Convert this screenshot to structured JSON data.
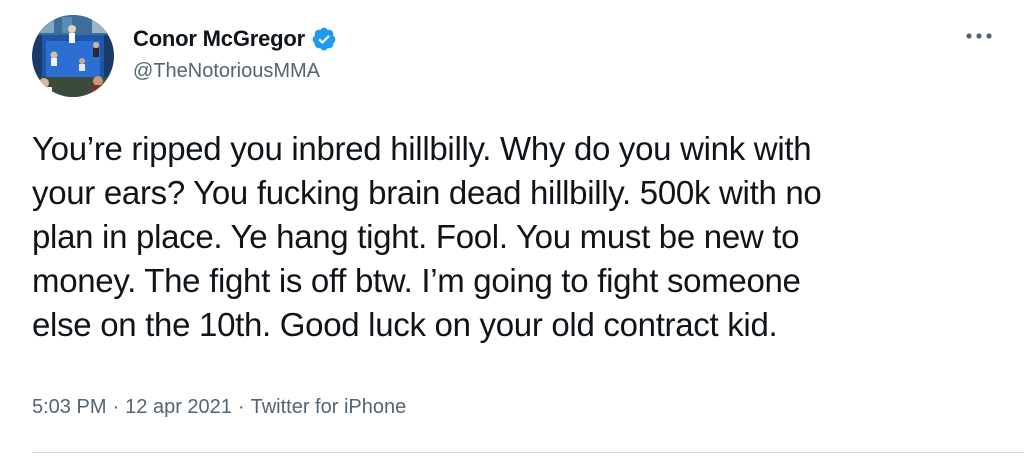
{
  "author": {
    "display_name": "Conor McGregor",
    "handle": "@TheNotoriousMMA",
    "verified_icon": "verified-badge-icon",
    "verified_color": "#1d9bf0"
  },
  "tweet": {
    "text": "You’re ripped you inbred hillbilly. Why do you wink with\nyour ears? You fucking brain dead hillbilly. 500k with no\nplan in place. Ye hang tight. Fool. You must be new to\nmoney. The fight is off btw. I’m going to fight someone\nelse on the 10th. Good luck on your old contract kid."
  },
  "meta": {
    "time": "5:03 PM",
    "separator": "·",
    "date": "12 apr 2021",
    "source": "Twitter for iPhone"
  },
  "icons": {
    "more": "more-dots-icon",
    "avatar": "avatar-image"
  },
  "colors": {
    "text_primary": "#0f1419",
    "text_secondary": "#536471",
    "divider": "#cfd9de"
  }
}
